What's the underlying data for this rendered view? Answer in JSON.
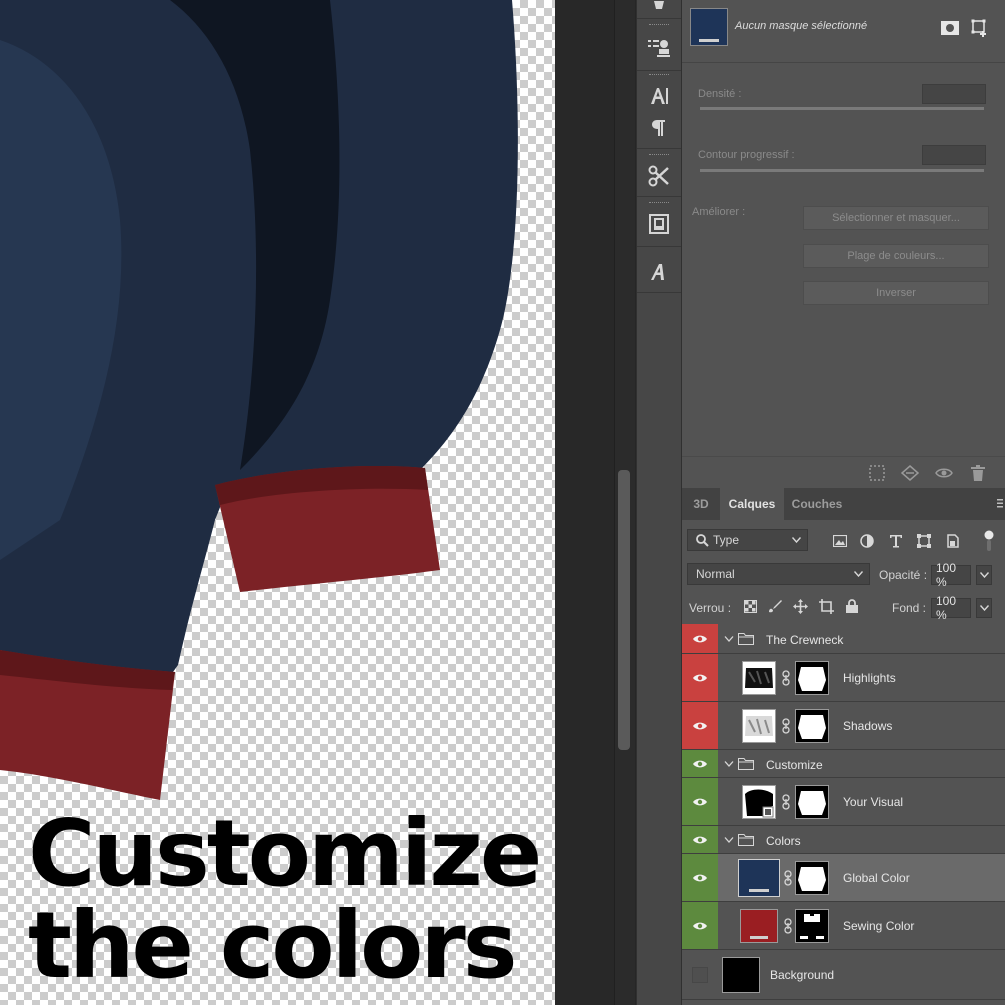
{
  "canvas": {
    "caption_lines": [
      "Customize",
      "the colors"
    ],
    "garment_colors": {
      "body": "#1f2c42",
      "body_light": "#2c3f5c",
      "cuff": "#7c2226",
      "cuff_dark": "#5e171a"
    }
  },
  "tool_strip": {
    "tools": [
      "clone-source-icon",
      "character-icon",
      "paragraph-icon",
      "tool-presets-icon",
      "brush-settings-icon",
      "glyphs-icon"
    ]
  },
  "properties": {
    "title": "Aucun masque sélectionné",
    "density_label": "Densité :",
    "feather_label": "Contour progressif :",
    "refine_label": "Améliorer :",
    "buttons": [
      "Sélectionner et masquer...",
      "Plage de couleurs...",
      "Inverser"
    ]
  },
  "layers_panel": {
    "tabs": [
      "3D",
      "Calques",
      "Couches"
    ],
    "active_tab": "Calques",
    "filter": "Type",
    "blend_mode": "Normal",
    "opacity_label": "Opacité :",
    "opacity": "100 %",
    "lock_label": "Verrou :",
    "fill_label": "Fond :",
    "fill": "100 %",
    "layers": [
      {
        "name": "The Crewneck",
        "kind": "group",
        "color": "#c9413f"
      },
      {
        "name": "Highlights",
        "kind": "layer",
        "color": "#c9413f"
      },
      {
        "name": "Shadows",
        "kind": "layer",
        "color": "#c9413f"
      },
      {
        "name": "Customize",
        "kind": "group",
        "color": "#5d8a3e"
      },
      {
        "name": "Your Visual",
        "kind": "layer",
        "color": "#5d8a3e"
      },
      {
        "name": "Colors",
        "kind": "group",
        "color": "#5d8a3e"
      },
      {
        "name": "Global Color",
        "kind": "layer",
        "color": "#5d8a3e",
        "swatch": "#1e3458"
      },
      {
        "name": "Sewing Color",
        "kind": "layer",
        "color": "#5d8a3e",
        "swatch": "#9a1e22"
      },
      {
        "name": "Background",
        "kind": "layer",
        "swatch": "#000000"
      }
    ]
  }
}
